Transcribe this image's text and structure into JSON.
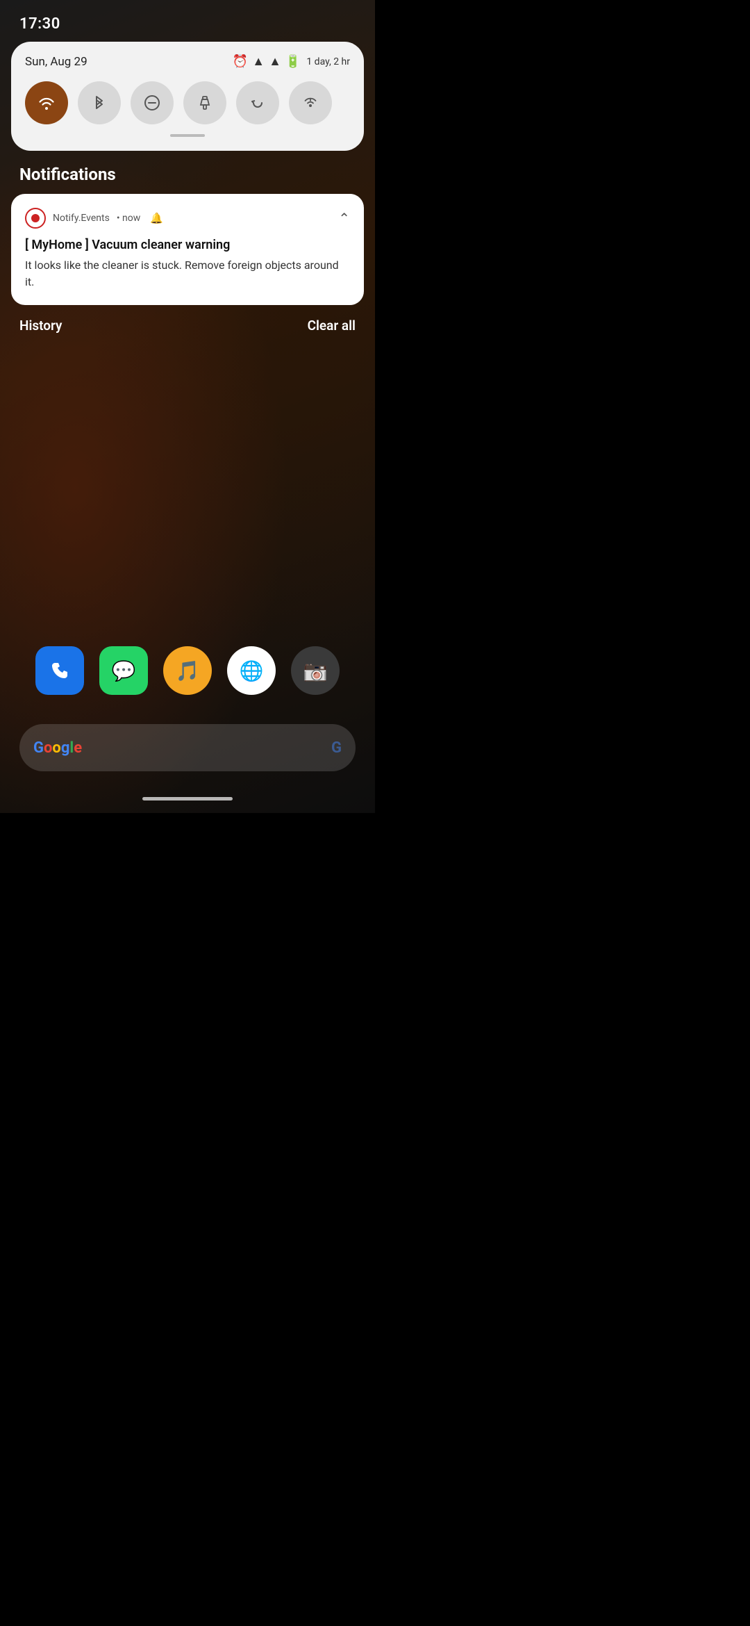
{
  "status_bar": {
    "time": "17:30",
    "date": "Sun, Aug 29",
    "battery_text": "1 day, 2 hr"
  },
  "quick_toggles": [
    {
      "id": "wifi",
      "label": "Wi-Fi",
      "active": true,
      "icon": "wifi"
    },
    {
      "id": "bluetooth",
      "label": "Bluetooth",
      "active": false,
      "icon": "bluetooth"
    },
    {
      "id": "dnd",
      "label": "Do Not Disturb",
      "active": false,
      "icon": "minus-circle"
    },
    {
      "id": "flashlight",
      "label": "Flashlight",
      "active": false,
      "icon": "flashlight"
    },
    {
      "id": "autorotate",
      "label": "Auto Rotate",
      "active": false,
      "icon": "rotate"
    },
    {
      "id": "hotspot",
      "label": "Hotspot",
      "active": false,
      "icon": "hotspot"
    }
  ],
  "notifications_label": "Notifications",
  "notification": {
    "app_name": "Notify.Events",
    "time": "now",
    "has_bell": true,
    "title": "[ MyHome ] Vacuum cleaner warning",
    "body": "It looks like the cleaner is stuck. Remove foreign objects around it."
  },
  "actions": {
    "history_label": "History",
    "clear_all_label": "Clear all"
  },
  "search_bar": {
    "google_letters": [
      "G",
      "o",
      "o",
      "g",
      "l",
      "e"
    ]
  }
}
